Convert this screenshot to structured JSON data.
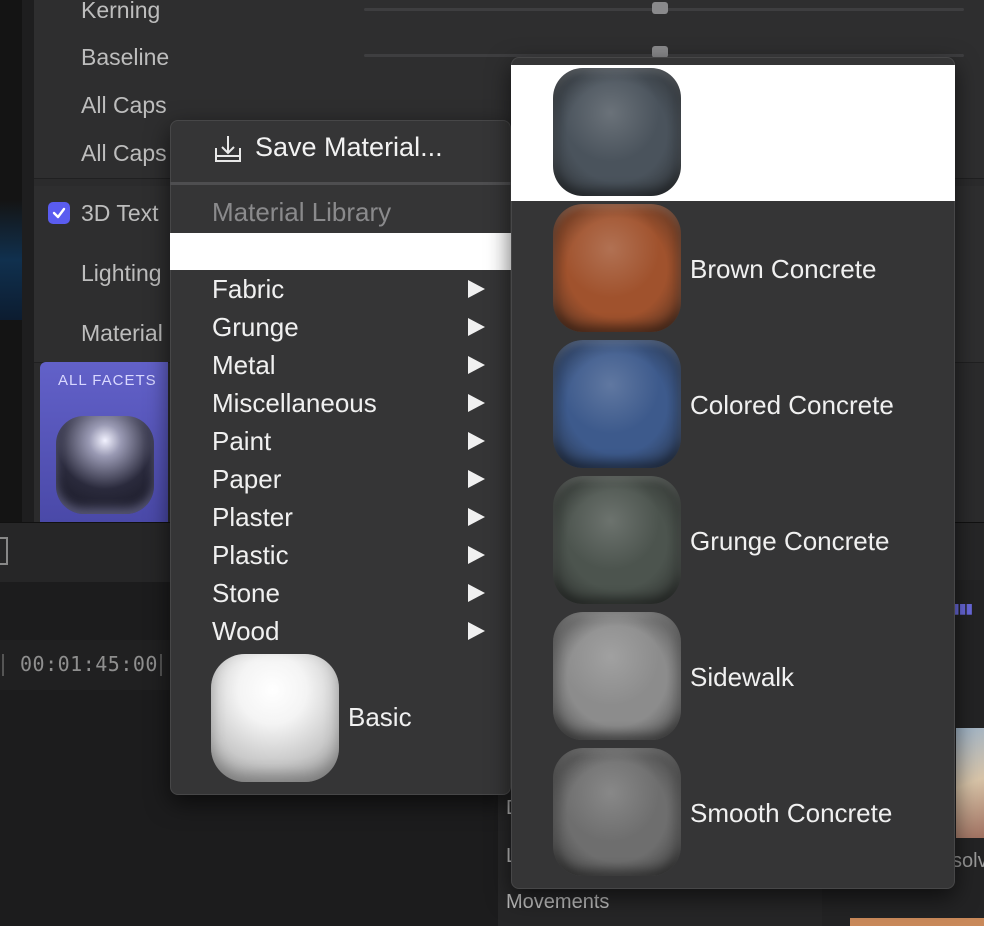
{
  "inspector": {
    "rows": {
      "kerning": "Kerning",
      "baseline": "Baseline",
      "all_caps": "All Caps",
      "all_caps_size": "All Caps",
      "text_3d": "3D Text",
      "lighting": "Lighting",
      "material": "Material"
    },
    "text_3d_checked": true,
    "facet_label": "ALL FACETS"
  },
  "timeline": {
    "timecode": "00:01:45:00"
  },
  "browser": {
    "item_d": "D",
    "item_l": "L",
    "movements": "Movements",
    "partial_text": "solv"
  },
  "menu": {
    "save_label": "Save Material...",
    "library_header": "Material Library",
    "categories": [
      {
        "label": "Fabric"
      },
      {
        "label": "Grunge"
      },
      {
        "label": "Metal"
      },
      {
        "label": "Miscellaneous"
      },
      {
        "label": "Paint"
      },
      {
        "label": "Paper"
      },
      {
        "label": "Plaster"
      },
      {
        "label": "Plastic"
      },
      {
        "label": "Stone"
      },
      {
        "label": "Wood"
      }
    ],
    "basic_label": "Basic"
  },
  "submenu": {
    "items": [
      {
        "label": "",
        "color": "#4a535c"
      },
      {
        "label": "Brown Concrete",
        "color": "#a0522d"
      },
      {
        "label": "Colored Concrete",
        "color": "#3d5a8c"
      },
      {
        "label": "Grunge Concrete",
        "color": "#4c544e"
      },
      {
        "label": "Sidewalk",
        "color": "#8c8c8c"
      },
      {
        "label": "Smooth Concrete",
        "color": "#6e6e6e"
      }
    ]
  },
  "colors": {
    "accent": "#5a5cf0",
    "menu_bg": "#353536",
    "highlight": "#ffffff"
  }
}
